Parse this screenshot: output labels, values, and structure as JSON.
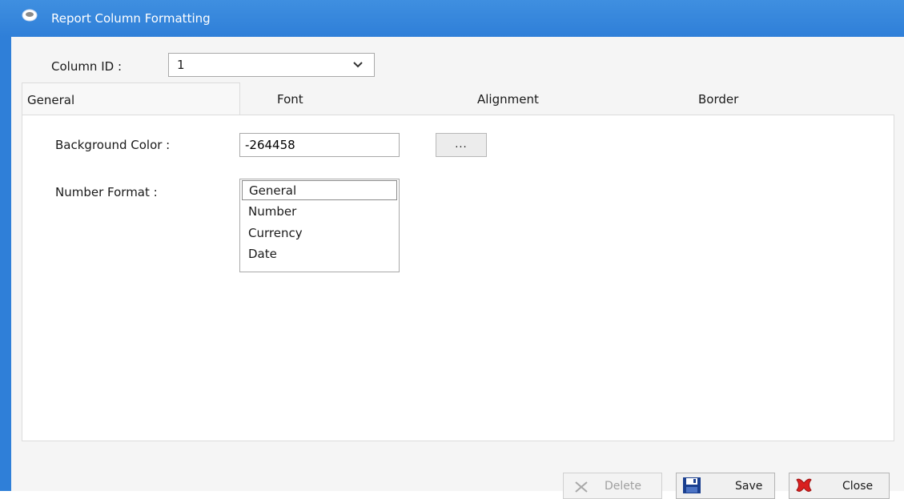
{
  "window": {
    "title": "Report Column Formatting",
    "icon": "app-icon"
  },
  "column_id": {
    "label": "Column ID :",
    "value": "1"
  },
  "tabs": [
    {
      "label": "General",
      "active": true
    },
    {
      "label": "Font",
      "active": false
    },
    {
      "label": "Alignment",
      "active": false
    },
    {
      "label": "Border",
      "active": false
    }
  ],
  "general": {
    "background_color": {
      "label": "Background Color :",
      "value": "-264458",
      "browse_label": "..."
    },
    "number_format": {
      "label": "Number Format :",
      "options": [
        "General",
        "Number",
        "Currency",
        "Date"
      ],
      "selected": "General"
    }
  },
  "buttons": {
    "delete": {
      "label": "Delete",
      "enabled": false,
      "icon": "x-icon"
    },
    "save": {
      "label": "Save",
      "enabled": true,
      "icon": "floppy-disk-icon"
    },
    "close": {
      "label": "Close",
      "enabled": true,
      "icon": "red-x-icon"
    }
  },
  "colors": {
    "titlebar": "#2f7fd8",
    "close_icon": "#d92020",
    "save_icon": "#1a3f8f"
  }
}
